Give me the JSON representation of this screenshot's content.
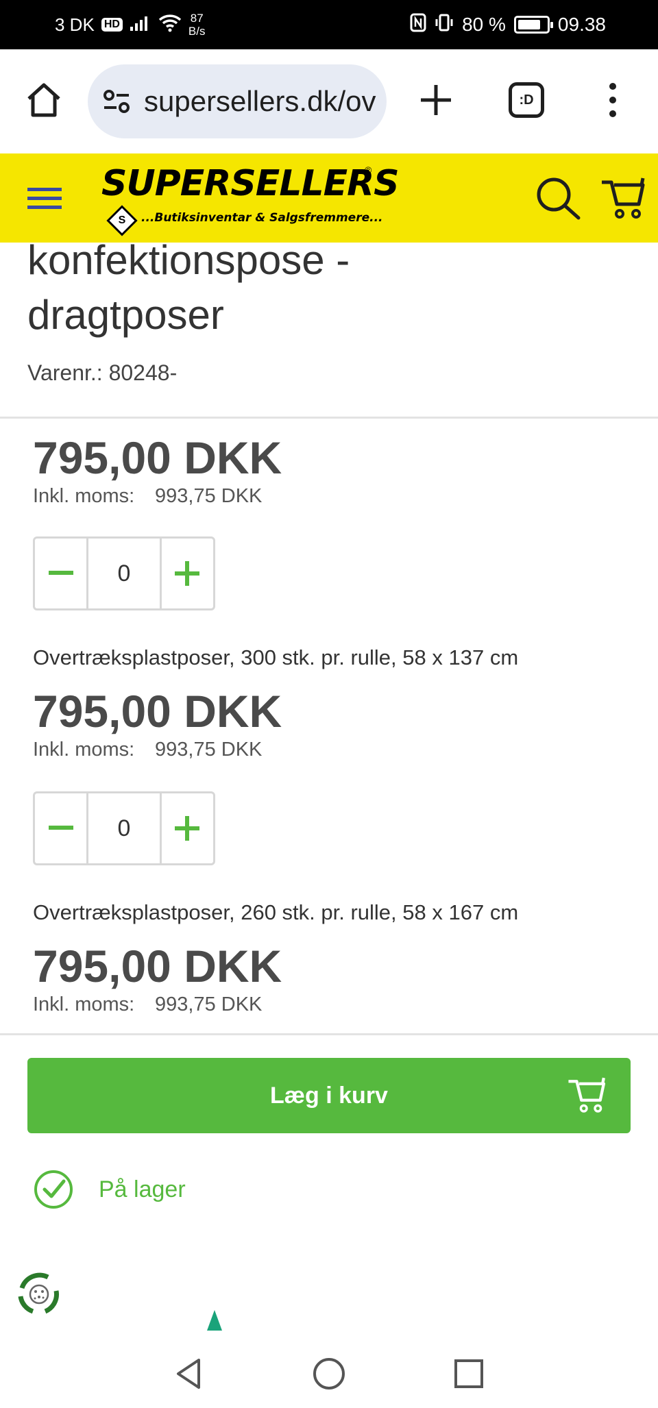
{
  "status_bar": {
    "carrier": "3 DK",
    "hd_badge": "HD",
    "net_speed_value": "87",
    "net_speed_unit": "B/s",
    "battery": "80 %",
    "battery_level": 0.8,
    "time": "09.38"
  },
  "browser": {
    "url": "supersellers.dk/ov",
    "tab_count": ":D"
  },
  "site": {
    "logo_text": "SUPERSELLERS",
    "logo_registered": "®",
    "logo_mark": "S",
    "tagline": "...Butiksinventar & Salgsfremmere...",
    "brand_color": "#f5e600",
    "accent_color": "#56b93e"
  },
  "product": {
    "title_line1": "konfektionspose -",
    "title_line2": "dragtposer",
    "sku": "Varenr.: 80248-"
  },
  "variants": [
    {
      "name": "",
      "price": "795,00 DKK",
      "vat_label": "Inkl. moms:",
      "vat_price": "993,75 DKK",
      "quantity": "0"
    },
    {
      "name": "Overtræksplastposer, 300 stk. pr. rulle, 58 x 137 cm",
      "price": "795,00 DKK",
      "vat_label": "Inkl. moms:",
      "vat_price": "993,75 DKK",
      "quantity": "0"
    },
    {
      "name": "Overtræksplastposer, 260 stk. pr. rulle, 58 x 167 cm",
      "price": "795,00 DKK",
      "vat_label": "Inkl. moms:",
      "vat_price": "993,75 DKK"
    }
  ],
  "cart": {
    "add_label": "Læg i kurv"
  },
  "stock": {
    "label": "På lager"
  },
  "icons": {
    "home": "home-icon",
    "tune": "site-info-icon",
    "new_tab": "plus-icon",
    "tabs": "tab-switcher-icon",
    "menu": "more-vert-icon",
    "hamburger": "hamburger-icon",
    "search": "search-icon",
    "cart": "cart-icon",
    "minus": "minus-icon",
    "plus": "plus-icon",
    "check": "check-circle-icon",
    "eco": "recycle-icon",
    "back": "back-icon",
    "home_nav": "home-circle-icon",
    "recents": "recents-icon"
  }
}
